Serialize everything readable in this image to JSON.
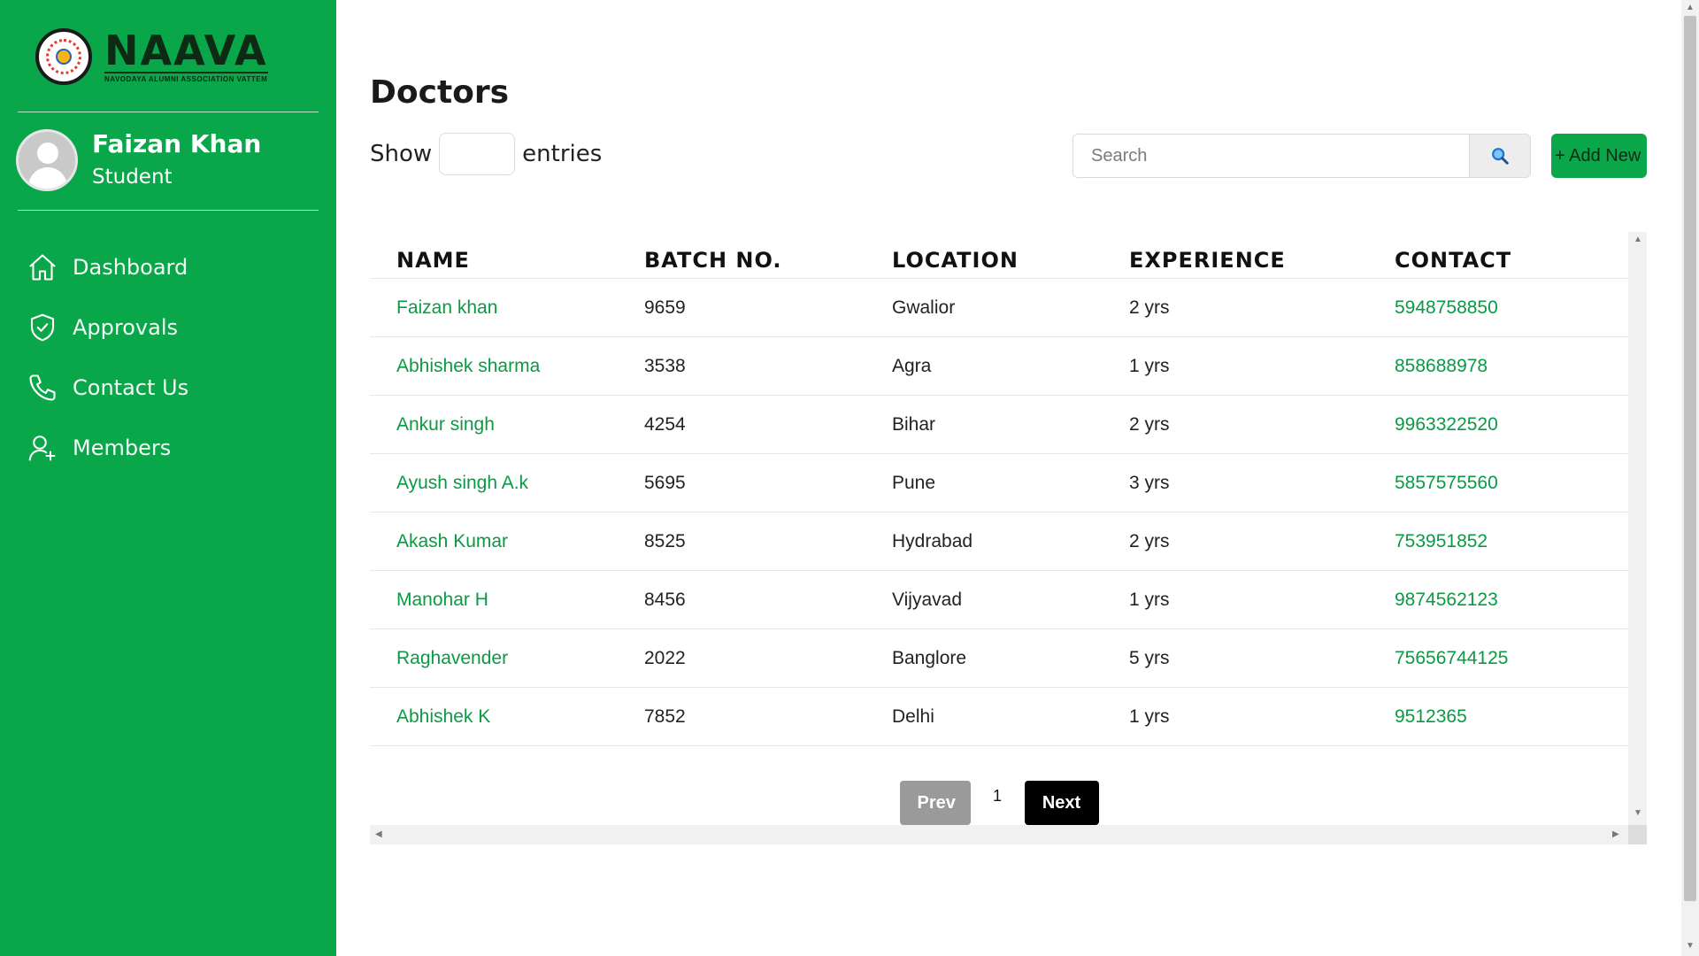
{
  "brand": {
    "name": "NAAVA",
    "tagline": "NAVODAYA ALUMNI ASSOCIATION VATTEM"
  },
  "profile": {
    "name": "Faizan Khan",
    "role": "Student"
  },
  "nav": [
    {
      "label": "Dashboard",
      "icon": "home-icon"
    },
    {
      "label": "Approvals",
      "icon": "shield-check-icon"
    },
    {
      "label": "Contact Us",
      "icon": "phone-icon"
    },
    {
      "label": "Members",
      "icon": "user-add-icon"
    }
  ],
  "page": {
    "title": "Doctors"
  },
  "controls": {
    "show_label": "Show",
    "entries_label": "entries",
    "search_placeholder": "Search",
    "search_icon": "magnifier-icon",
    "add_label": "+ Add New"
  },
  "table": {
    "headers": [
      "NAME",
      "BATCH NO.",
      "LOCATION",
      "EXPERIENCE",
      "CONTACT"
    ],
    "rows": [
      [
        "Faizan khan",
        "9659",
        "Gwalior",
        "2 yrs",
        "5948758850"
      ],
      [
        "Abhishek sharma",
        "3538",
        "Agra",
        "1 yrs",
        "858688978"
      ],
      [
        "Ankur singh",
        "4254",
        "Bihar",
        "2 yrs",
        "9963322520"
      ],
      [
        "Ayush singh A.k",
        "5695",
        "Pune",
        "3 yrs",
        "5857575560"
      ],
      [
        "Akash Kumar",
        "8525",
        "Hydrabad",
        "2 yrs",
        "753951852"
      ],
      [
        "Manohar H",
        "8456",
        "Vijyavad",
        "1 yrs",
        "9874562123"
      ],
      [
        "Raghavender",
        "2022",
        "Banglore",
        "5 yrs",
        "75656744125"
      ],
      [
        "Abhishek K",
        "7852",
        "Delhi",
        "1 yrs",
        "9512365"
      ]
    ]
  },
  "pagination": {
    "prev": "Prev",
    "current": "1",
    "next": "Next"
  },
  "colors": {
    "sidebar": "#0aa64a",
    "accent_text": "#0a9a44",
    "next_button": "#000000",
    "prev_button": "#9a9a9a"
  }
}
